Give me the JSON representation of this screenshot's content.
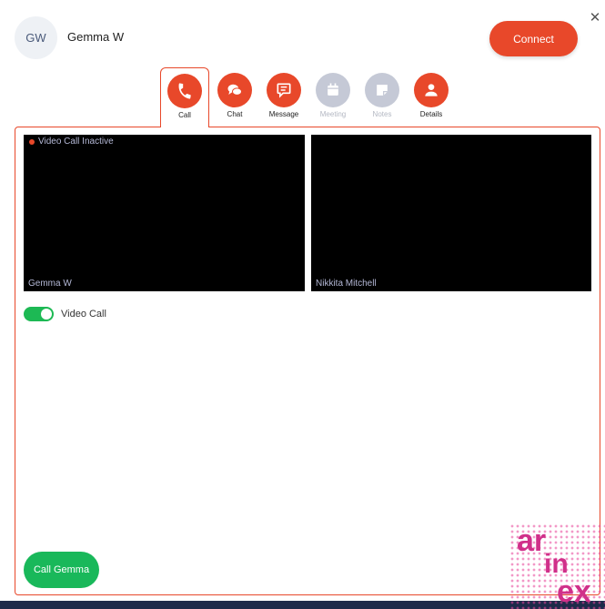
{
  "contact": {
    "initials": "GW",
    "name": "Gemma W"
  },
  "header": {
    "connect_label": "Connect",
    "close_glyph": "✕"
  },
  "tabs": [
    {
      "label": "Call",
      "icon": "phone-icon",
      "state": "active"
    },
    {
      "label": "Chat",
      "icon": "chat-icon",
      "state": "enabled"
    },
    {
      "label": "Message",
      "icon": "message-icon",
      "state": "enabled"
    },
    {
      "label": "Meeting",
      "icon": "calendar-icon",
      "state": "disabled"
    },
    {
      "label": "Notes",
      "icon": "note-icon",
      "state": "disabled"
    },
    {
      "label": "Details",
      "icon": "person-icon",
      "state": "enabled"
    }
  ],
  "call": {
    "status": "Video Call Inactive",
    "local_name": "Gemma W",
    "remote_name": "Nikkita Mitchell",
    "video_toggle_label": "Video Call",
    "video_toggle_on": true,
    "call_button_label": "Call Gemma"
  },
  "watermark": {
    "line1": "ar",
    "line2": "in",
    "line3": "ex"
  },
  "colors": {
    "accent": "#e8482a",
    "success": "#19b85a",
    "disabled": "#c5c9d6",
    "footer": "#1e2a4a"
  }
}
